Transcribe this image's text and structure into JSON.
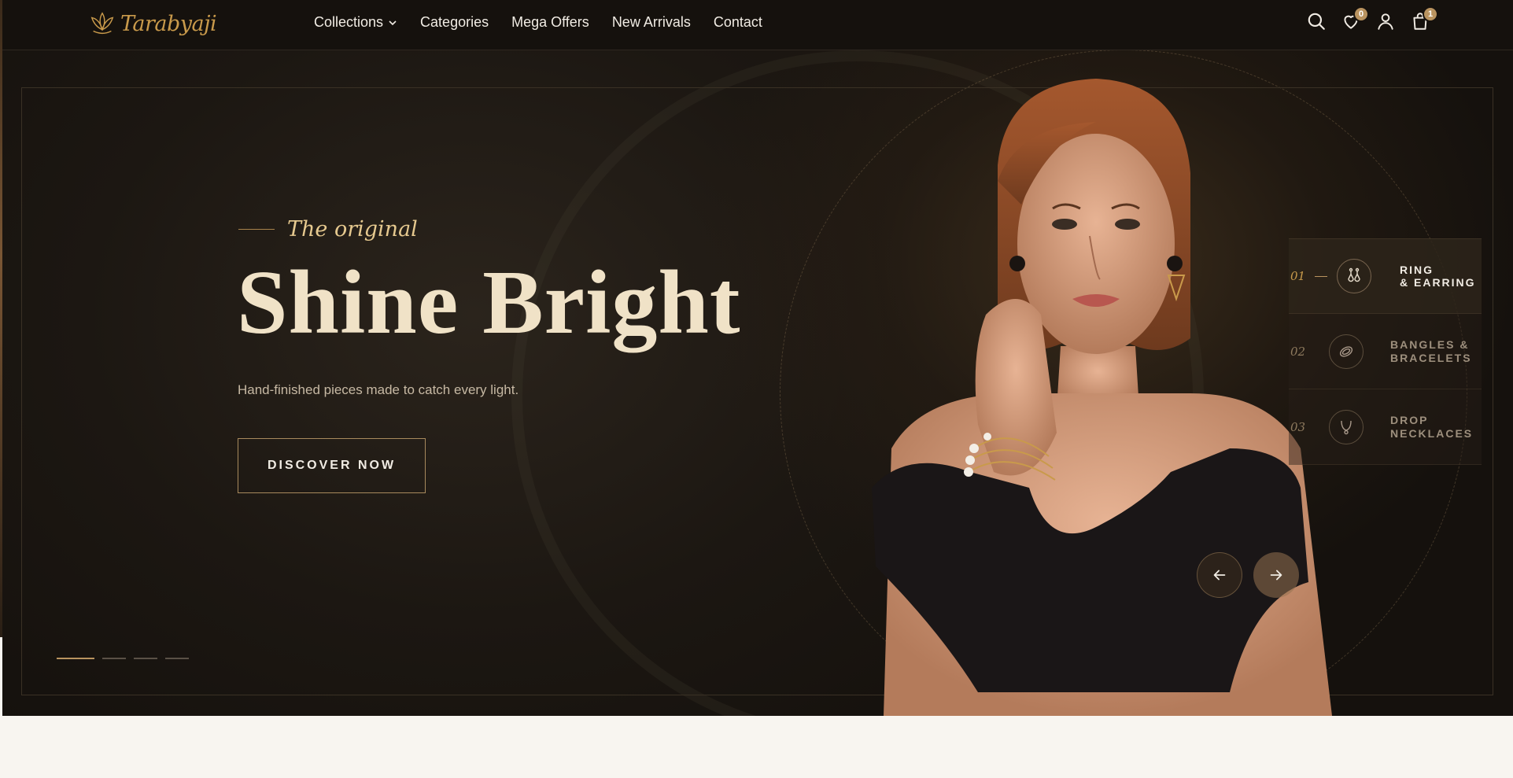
{
  "brand": {
    "name": "Tarabyaji",
    "logo_icon": "lotus-icon",
    "accent": "#c99a4b"
  },
  "nav": {
    "items": [
      {
        "label": "Collections",
        "has_dropdown": true
      },
      {
        "label": "Categories"
      },
      {
        "label": "Mega Offers"
      },
      {
        "label": "New Arrivals"
      },
      {
        "label": "Contact"
      }
    ]
  },
  "header_icons": {
    "search": "search-icon",
    "wishlist": {
      "icon": "heart-icon",
      "count": "0"
    },
    "account": "user-icon",
    "cart": {
      "icon": "shopping-bag-icon",
      "count": "1"
    }
  },
  "hero": {
    "eyebrow": "The original",
    "headline": "Shine Bright",
    "subtitle": "Hand-finished pieces made to catch every light.",
    "cta_label": "DISCOVER NOW",
    "slide_count": 4,
    "active_slide": 1
  },
  "categories": [
    {
      "num": "01",
      "label": "RING\n& EARRING",
      "icon": "earring-icon",
      "active": true
    },
    {
      "num": "02",
      "label": "BANGLES &\nBRACELETS",
      "icon": "bracelet-icon",
      "active": false
    },
    {
      "num": "03",
      "label": "DROP\nNECKLACES",
      "icon": "necklace-icon",
      "active": false
    }
  ],
  "colors": {
    "hero_bg": "#1c1712",
    "headline": "#f0e2c7",
    "gold": "#b9935f",
    "page_bg": "#f8f5f0"
  }
}
